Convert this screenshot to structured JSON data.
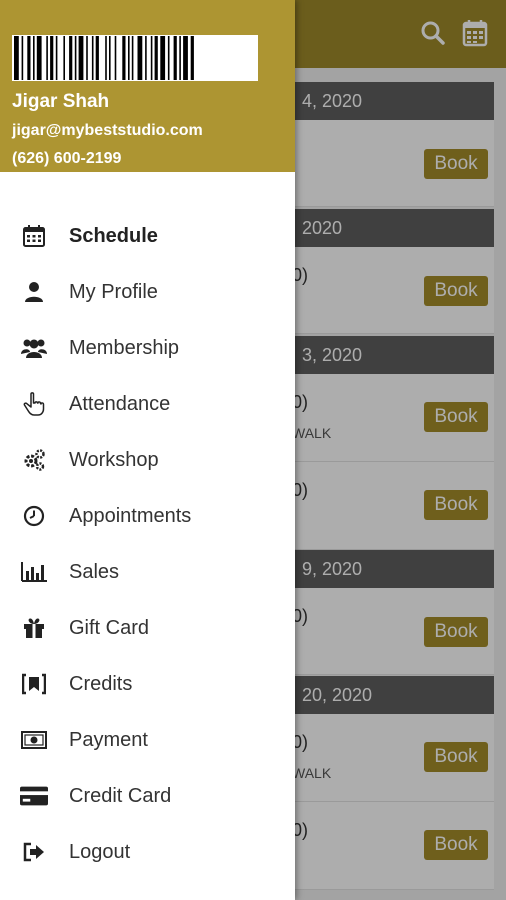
{
  "header": {
    "search_icon": "search-icon",
    "calendar_icon": "calendar-icon",
    "color": "#9e8a2a"
  },
  "schedule": {
    "days": [
      {
        "header": "4, 2020",
        "rows": [
          {
            "text": "",
            "sub": "",
            "book": "Book"
          }
        ]
      },
      {
        "header": " 2020",
        "rows": [
          {
            "text": "0)",
            "sub": "",
            "book": "Book"
          }
        ]
      },
      {
        "header": "3, 2020",
        "rows": [
          {
            "text": "0)",
            "sub": "WALK",
            "book": "Book"
          },
          {
            "text": "0)",
            "sub": "",
            "book": "Book"
          }
        ]
      },
      {
        "header": "9, 2020",
        "rows": [
          {
            "text": "0)",
            "sub": "",
            "book": "Book"
          }
        ]
      },
      {
        "header": "20, 2020",
        "rows": [
          {
            "text": "0)",
            "sub": "WALK",
            "book": "Book"
          },
          {
            "text": "0)",
            "sub": "",
            "book": "Book"
          }
        ]
      }
    ]
  },
  "drawer": {
    "user": {
      "name": "Jigar Shah",
      "email": "jigar@mybeststudio.com",
      "phone": "(626) 600-2199"
    },
    "accent": "#ad9532",
    "items": [
      {
        "label": "Schedule",
        "icon": "calendar-icon",
        "active": true
      },
      {
        "label": "My Profile",
        "icon": "user-icon"
      },
      {
        "label": "Membership",
        "icon": "users-icon"
      },
      {
        "label": "Attendance",
        "icon": "hand-pointer-icon"
      },
      {
        "label": "Workshop",
        "icon": "gears-icon"
      },
      {
        "label": "Appointments",
        "icon": "clock-icon"
      },
      {
        "label": "Sales",
        "icon": "bar-chart-icon"
      },
      {
        "label": "Gift Card",
        "icon": "gift-icon"
      },
      {
        "label": "Credits",
        "icon": "credits-icon"
      },
      {
        "label": "Payment",
        "icon": "money-icon"
      },
      {
        "label": "Credit Card",
        "icon": "credit-card-icon"
      },
      {
        "label": "Logout",
        "icon": "logout-icon"
      }
    ]
  }
}
